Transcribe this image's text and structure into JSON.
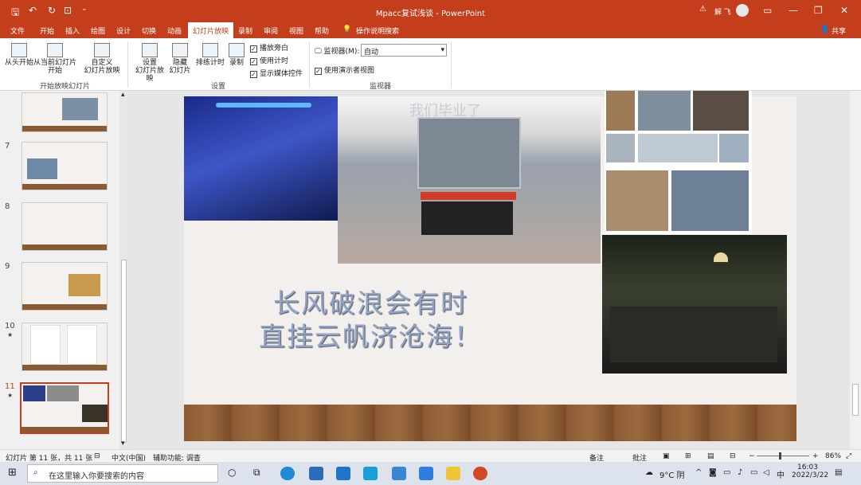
{
  "window": {
    "title": "Mpacc复试浅谈 - PowerPoint",
    "user": "解 飞",
    "warning_icon": "warning-icon"
  },
  "tabs": [
    "文件",
    "开始",
    "插入",
    "绘图",
    "设计",
    "切换",
    "动画",
    "幻灯片放映",
    "录制",
    "审阅",
    "视图",
    "帮助"
  ],
  "active_tab": "幻灯片放映",
  "tell_me": "操作说明搜索",
  "share": "共享",
  "ribbon": {
    "from_start": "从头开始",
    "from_current_1": "从当前幻灯片",
    "from_current_2": "开始",
    "custom_1": "自定义",
    "custom_2": "幻灯片放映",
    "group_start": "开始放映幻灯片",
    "setup_1": "设置",
    "setup_2": "幻灯片放映",
    "hide_1": "隐藏",
    "hide_2": "幻灯片",
    "rehearse": "排练计时",
    "record": "录制",
    "play_narration": "播放旁白",
    "use_timings": "使用计时",
    "show_media": "显示媒体控件",
    "group_setup": "设置",
    "monitor_label": "监视器(M):",
    "monitor_value": "自动",
    "presenter_view": "使用演示者视图",
    "group_monitor": "监视器"
  },
  "thumbs": [
    {
      "n": ""
    },
    {
      "n": "7"
    },
    {
      "n": "8"
    },
    {
      "n": "9"
    },
    {
      "n": "10",
      "star": "★"
    },
    {
      "n": "11",
      "star": "★"
    }
  ],
  "slide": {
    "line1": "长风破浪会有时",
    "line2": "直挂云帆济沧海！",
    "watermark": "我们毕业了"
  },
  "status": {
    "slide_info": "幻灯片 第 11 张，共 11 张",
    "language": "中文(中国)",
    "accessibility": "辅助功能: 调查",
    "notes": "备注",
    "comments": "批注",
    "zoom": "86%"
  },
  "taskbar": {
    "search_placeholder": "在这里输入你要搜索的内容",
    "weather": "9°C 阴",
    "ime": "中",
    "time": "16:03",
    "date": "2022/3/22"
  }
}
